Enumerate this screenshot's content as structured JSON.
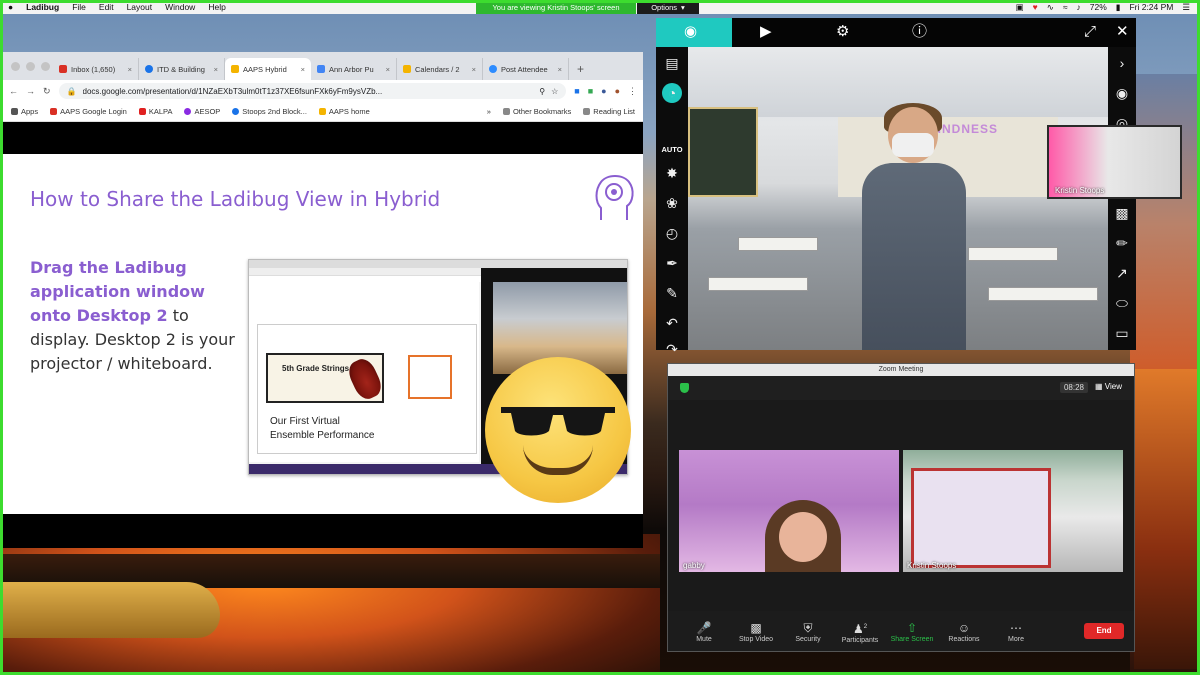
{
  "menubar": {
    "apple": "",
    "app": "Ladibug",
    "items": [
      "File",
      "Edit",
      "Layout",
      "Window",
      "Help"
    ],
    "viewing": "You are viewing Kristin Stoops' screen",
    "options": "Options",
    "battery": "72%",
    "clock": "Fri 2:24 PM"
  },
  "browser": {
    "tabs": [
      {
        "label": "Inbox (1,650)",
        "color": "#d93025"
      },
      {
        "label": "ITD & Building",
        "color": "#1a73e8"
      },
      {
        "label": "AAPS Hybrid",
        "color": "#f4b400"
      },
      {
        "label": "Ann Arbor Pu",
        "color": "#4285f4"
      },
      {
        "label": "Calendars / 2",
        "color": "#f4b400"
      },
      {
        "label": "Post Attendee",
        "color": "#2d8cff"
      }
    ],
    "url": "docs.google.com/presentation/d/1NZaEXbT3ulm0tT1z37XE6fsunFXk6yFm9ysVZb...",
    "bookmarks": [
      {
        "label": "Apps",
        "color": "#555"
      },
      {
        "label": "AAPS Google Login",
        "color": "#d93025"
      },
      {
        "label": "KALPA",
        "color": "#e02020"
      },
      {
        "label": "AESOP",
        "color": "#8a2be2"
      },
      {
        "label": "Stoops 2nd Block...",
        "color": "#1a73e8"
      },
      {
        "label": "AAPS home",
        "color": "#f4b400"
      }
    ],
    "other_bookmarks": "Other Bookmarks",
    "reading_list": "Reading List"
  },
  "slide": {
    "title": "How to Share the Ladibug View in Hybrid",
    "body_highlight": "Drag the Ladibug application window onto Desktop 2",
    "body_rest": " to display. Desktop 2 is your projector / whiteboard.",
    "mini_strings": "5th Grade Strings",
    "mini_line1": "Our First Virtual",
    "mini_line2": "Ensemble Performance"
  },
  "ladibug": {
    "auto": "AUTO",
    "sign": "KINDNESS",
    "pip_name": "Kristin Stoops"
  },
  "zoom": {
    "title": "Zoom Meeting",
    "time": "08:28",
    "view": "View",
    "tile1_name": "gabby",
    "tile2_name": "Kristin Stoops",
    "controls": [
      "Mute",
      "Stop Video",
      "Security",
      "Participants",
      "Share Screen",
      "Reactions",
      "More"
    ],
    "participants_count": "2",
    "end": "End"
  },
  "colors": {
    "accent_green": "#3ddc2f",
    "ladibug_teal": "#1fc9c0",
    "slide_purple": "#8a5ed0",
    "zoom_red": "#e02828"
  }
}
